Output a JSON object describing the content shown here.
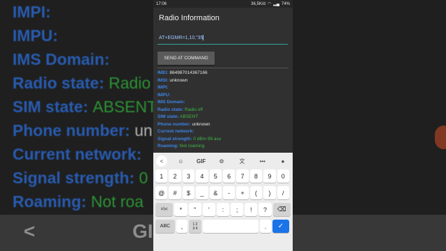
{
  "background": {
    "lines": [
      {
        "label": "IMPI:",
        "value": ""
      },
      {
        "label": "IMPU:",
        "value": ""
      },
      {
        "label": "IMS Domain:",
        "value": ""
      },
      {
        "label": "Radio state:",
        "value": "Radio"
      },
      {
        "label": "SIM state:",
        "value": "ABSENT"
      },
      {
        "label": "Phone number:",
        "value": "un"
      },
      {
        "label": "Current network:",
        "value": ""
      },
      {
        "label": "Signal strength:",
        "value": "0"
      },
      {
        "label": "Roaming:",
        "value": "Not roa"
      }
    ],
    "keyboard_glyphs": [
      "<",
      "GIF"
    ]
  },
  "statusbar": {
    "time": "17:06",
    "net_speed": "36,5K/d",
    "battery": "74%"
  },
  "app": {
    "title": "Radio Information"
  },
  "command": {
    "value": "AT+EGMR=1,10,\"35",
    "button_label": "SEND AT COMMAND"
  },
  "info": {
    "rows": [
      {
        "label": "IMEI:",
        "value": "864987014367166",
        "color": "white"
      },
      {
        "label": "IMSI:",
        "value": "unknown",
        "color": "white"
      },
      {
        "label": "IMPI:",
        "value": "",
        "color": "white"
      },
      {
        "label": "IMPU:",
        "value": "",
        "color": "white"
      },
      {
        "label": "IMS Domain:",
        "value": "",
        "color": "white"
      },
      {
        "label": "Radio state:",
        "value": "Radio off",
        "color": "green"
      },
      {
        "label": "SIM state:",
        "value": "ABSENT",
        "color": "green"
      },
      {
        "label": "Phone number:",
        "value": "unknown",
        "color": "white"
      },
      {
        "label": "Current network:",
        "value": "",
        "color": "white"
      },
      {
        "label": "Signal strength:",
        "value": "0 dBm   99 asu",
        "color": "green"
      },
      {
        "label": "Roaming:",
        "value": "Not roaming",
        "color": "green"
      }
    ]
  },
  "keyboard": {
    "toolbar": {
      "back": "<",
      "sticker": "☺",
      "gif": "GIF",
      "settings": "⚙",
      "translate": "文",
      "more": "•••",
      "mic": "🎤"
    },
    "number_row": [
      "1",
      "2",
      "3",
      "4",
      "5",
      "6",
      "7",
      "8",
      "9",
      "0"
    ],
    "symbol_row": [
      "@",
      "#",
      "$",
      "_",
      "&",
      "-",
      "+",
      "(",
      ")",
      "/"
    ],
    "row3": {
      "shift": "=\\<",
      "keys": [
        "*",
        "\"",
        "'",
        ":",
        ";",
        "!",
        "?"
      ],
      "backspace": "⌫"
    },
    "row4": {
      "abc": "ABC",
      "comma": ",",
      "numpad": "1 2\n3 4",
      "period": ".",
      "done": "✓"
    }
  },
  "colors": {
    "label_blue": "#3c84e8",
    "value_green": "#3fb845",
    "accent_teal": "#2ea6a6",
    "done_blue": "#1a73e8"
  }
}
